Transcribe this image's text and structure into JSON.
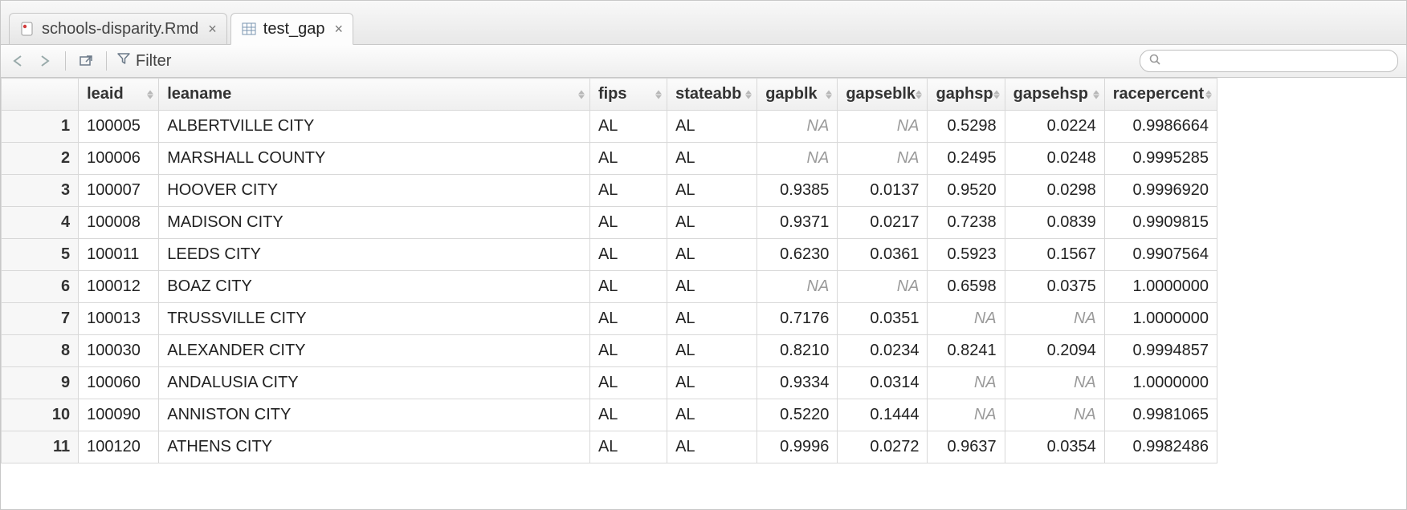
{
  "tabs": [
    {
      "label": "schools-disparity.Rmd",
      "icon": "rmd-file-icon",
      "active": false
    },
    {
      "label": "test_gap",
      "icon": "data-frame-icon",
      "active": true
    }
  ],
  "toolbar": {
    "filter_label": "Filter",
    "search_placeholder": ""
  },
  "columns": [
    {
      "key": "rownum",
      "label": ""
    },
    {
      "key": "leaid",
      "label": "leaid"
    },
    {
      "key": "leaname",
      "label": "leaname"
    },
    {
      "key": "fips",
      "label": "fips"
    },
    {
      "key": "stateabb",
      "label": "stateabb"
    },
    {
      "key": "gapblk",
      "label": "gapblk"
    },
    {
      "key": "gapseblk",
      "label": "gapseblk"
    },
    {
      "key": "gaphsp",
      "label": "gaphsp"
    },
    {
      "key": "gapsehsp",
      "label": "gapsehsp"
    },
    {
      "key": "racepercent",
      "label": "racepercent"
    }
  ],
  "rows": [
    {
      "n": "1",
      "leaid": "100005",
      "leaname": "ALBERTVILLE CITY",
      "fips": "AL",
      "stateabb": "AL",
      "gapblk": "NA",
      "gapseblk": "NA",
      "gaphsp": "0.5298",
      "gapsehsp": "0.0224",
      "racepercent": "0.9986664"
    },
    {
      "n": "2",
      "leaid": "100006",
      "leaname": "MARSHALL COUNTY",
      "fips": "AL",
      "stateabb": "AL",
      "gapblk": "NA",
      "gapseblk": "NA",
      "gaphsp": "0.2495",
      "gapsehsp": "0.0248",
      "racepercent": "0.9995285"
    },
    {
      "n": "3",
      "leaid": "100007",
      "leaname": "HOOVER CITY",
      "fips": "AL",
      "stateabb": "AL",
      "gapblk": "0.9385",
      "gapseblk": "0.0137",
      "gaphsp": "0.9520",
      "gapsehsp": "0.0298",
      "racepercent": "0.9996920"
    },
    {
      "n": "4",
      "leaid": "100008",
      "leaname": "MADISON CITY",
      "fips": "AL",
      "stateabb": "AL",
      "gapblk": "0.9371",
      "gapseblk": "0.0217",
      "gaphsp": "0.7238",
      "gapsehsp": "0.0839",
      "racepercent": "0.9909815"
    },
    {
      "n": "5",
      "leaid": "100011",
      "leaname": "LEEDS CITY",
      "fips": "AL",
      "stateabb": "AL",
      "gapblk": "0.6230",
      "gapseblk": "0.0361",
      "gaphsp": "0.5923",
      "gapsehsp": "0.1567",
      "racepercent": "0.9907564"
    },
    {
      "n": "6",
      "leaid": "100012",
      "leaname": "BOAZ CITY",
      "fips": "AL",
      "stateabb": "AL",
      "gapblk": "NA",
      "gapseblk": "NA",
      "gaphsp": "0.6598",
      "gapsehsp": "0.0375",
      "racepercent": "1.0000000"
    },
    {
      "n": "7",
      "leaid": "100013",
      "leaname": "TRUSSVILLE CITY",
      "fips": "AL",
      "stateabb": "AL",
      "gapblk": "0.7176",
      "gapseblk": "0.0351",
      "gaphsp": "NA",
      "gapsehsp": "NA",
      "racepercent": "1.0000000"
    },
    {
      "n": "8",
      "leaid": "100030",
      "leaname": "ALEXANDER CITY",
      "fips": "AL",
      "stateabb": "AL",
      "gapblk": "0.8210",
      "gapseblk": "0.0234",
      "gaphsp": "0.8241",
      "gapsehsp": "0.2094",
      "racepercent": "0.9994857"
    },
    {
      "n": "9",
      "leaid": "100060",
      "leaname": "ANDALUSIA CITY",
      "fips": "AL",
      "stateabb": "AL",
      "gapblk": "0.9334",
      "gapseblk": "0.0314",
      "gaphsp": "NA",
      "gapsehsp": "NA",
      "racepercent": "1.0000000"
    },
    {
      "n": "10",
      "leaid": "100090",
      "leaname": "ANNISTON CITY",
      "fips": "AL",
      "stateabb": "AL",
      "gapblk": "0.5220",
      "gapseblk": "0.1444",
      "gaphsp": "NA",
      "gapsehsp": "NA",
      "racepercent": "0.9981065"
    },
    {
      "n": "11",
      "leaid": "100120",
      "leaname": "ATHENS CITY",
      "fips": "AL",
      "stateabb": "AL",
      "gapblk": "0.9996",
      "gapseblk": "0.0272",
      "gaphsp": "0.9637",
      "gapsehsp": "0.0354",
      "racepercent": "0.9982486"
    }
  ],
  "na_label": "NA"
}
